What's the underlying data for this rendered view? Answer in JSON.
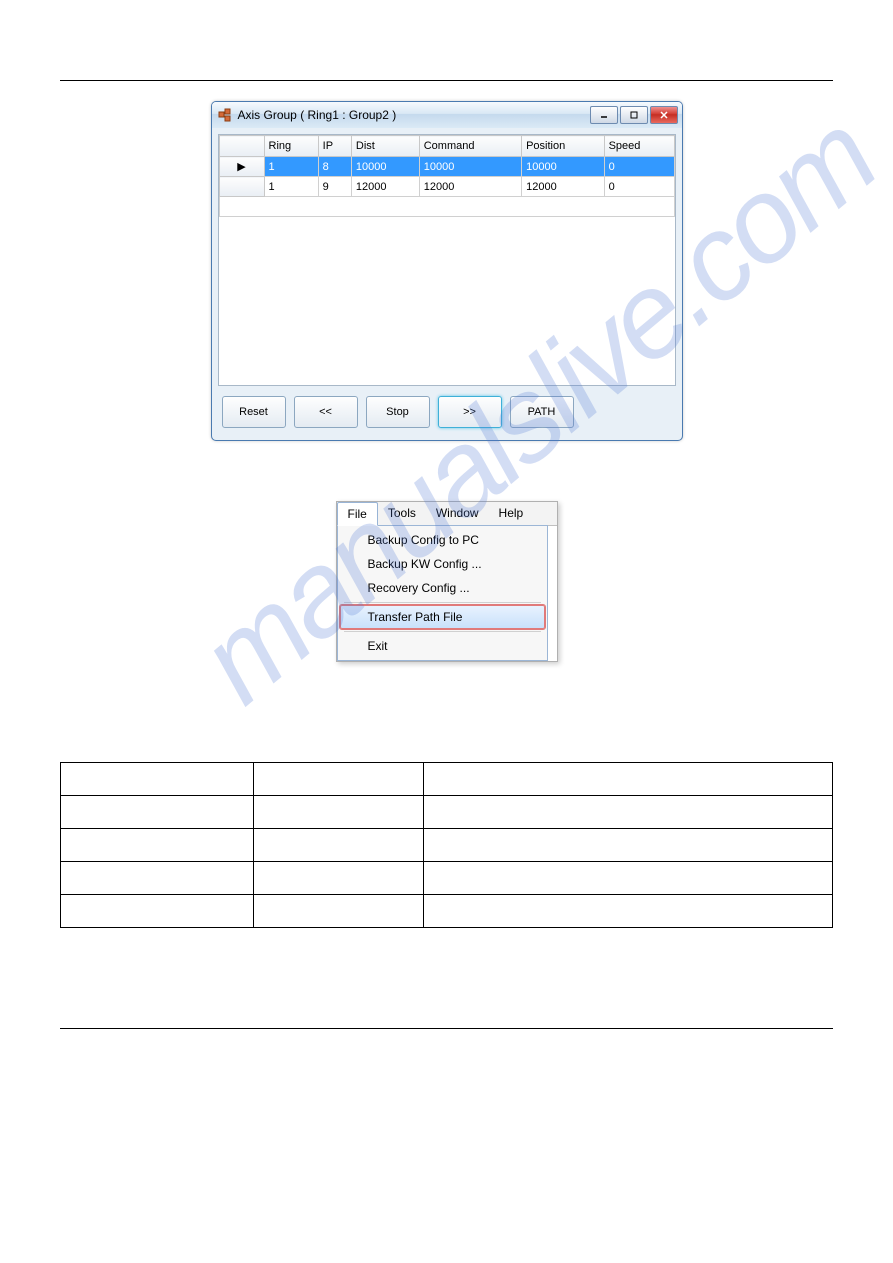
{
  "watermark": "manualslive.com",
  "window1": {
    "title": "Axis Group ( Ring1 : Group2 )",
    "columns": [
      "",
      "Ring",
      "IP",
      "Dist",
      "Command",
      "Position",
      "Speed"
    ],
    "rows": [
      {
        "marker": "▶",
        "ring": "1",
        "ip": "8",
        "dist": "10000",
        "command": "10000",
        "position": "10000",
        "speed": "0",
        "selected": true
      },
      {
        "marker": "",
        "ring": "1",
        "ip": "9",
        "dist": "12000",
        "command": "12000",
        "position": "12000",
        "speed": "0",
        "selected": false
      }
    ],
    "buttons": {
      "reset": "Reset",
      "back": "<<",
      "stop": "Stop",
      "fwd": ">>",
      "path": "PATH"
    }
  },
  "menus": {
    "bar": [
      "File",
      "Tools",
      "Window",
      "Help"
    ],
    "file_items": {
      "backup_pc": "Backup Config to PC",
      "backup_kw": "Backup KW Config ...",
      "recovery": "Recovery Config ...",
      "transfer": "Transfer Path File",
      "exit": "Exit"
    }
  }
}
